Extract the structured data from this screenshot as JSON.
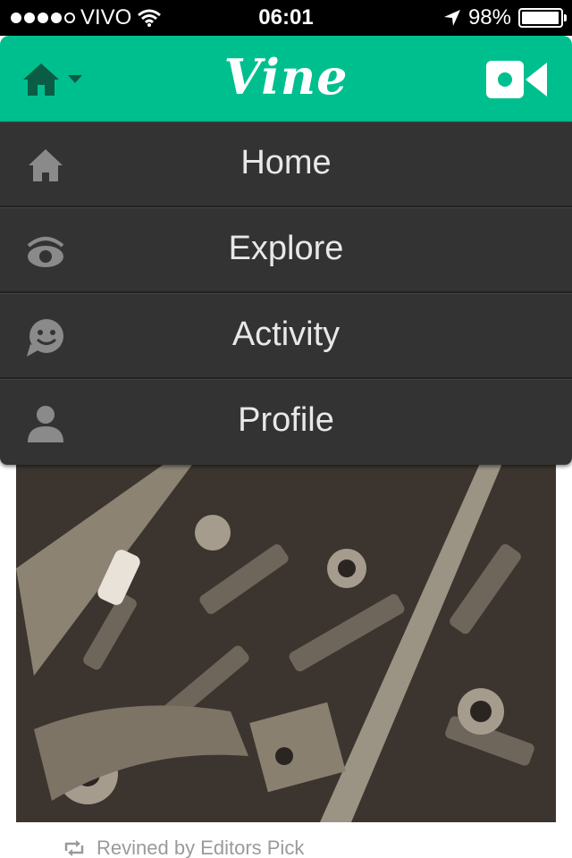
{
  "status_bar": {
    "carrier": "VIVO",
    "time": "06:01",
    "battery_percent": "98%",
    "battery_level": 0.98
  },
  "header": {
    "logo_text": "Vine",
    "brand_color": "#00bf8f",
    "home_icon": "home-icon",
    "camera_icon": "video-camera-icon"
  },
  "menu": {
    "items": [
      {
        "label": "Home",
        "icon": "home-icon"
      },
      {
        "label": "Explore",
        "icon": "eye-icon"
      },
      {
        "label": "Activity",
        "icon": "speech-smiley-icon"
      },
      {
        "label": "Profile",
        "icon": "person-icon"
      }
    ]
  },
  "feed": {
    "revine_text": "Revined by Editors Pick",
    "revine_icon": "revine-icon"
  }
}
